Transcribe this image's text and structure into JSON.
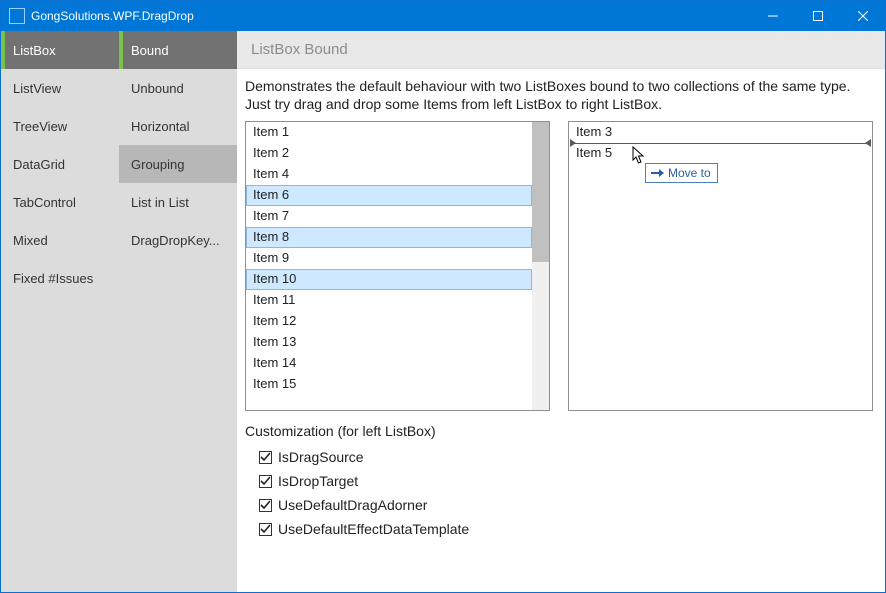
{
  "window": {
    "title": "GongSolutions.WPF.DragDrop"
  },
  "nav1": {
    "items": [
      {
        "label": "ListBox",
        "state": "active"
      },
      {
        "label": "ListView",
        "state": ""
      },
      {
        "label": "TreeView",
        "state": ""
      },
      {
        "label": "DataGrid",
        "state": ""
      },
      {
        "label": "TabControl",
        "state": ""
      },
      {
        "label": "Mixed",
        "state": ""
      },
      {
        "label": "Fixed #Issues",
        "state": ""
      }
    ]
  },
  "nav2": {
    "items": [
      {
        "label": "Bound",
        "state": "active"
      },
      {
        "label": "Unbound",
        "state": ""
      },
      {
        "label": "Horizontal",
        "state": ""
      },
      {
        "label": "Grouping",
        "state": "hover"
      },
      {
        "label": "List in List",
        "state": ""
      },
      {
        "label": "DragDropKey...",
        "state": ""
      }
    ]
  },
  "breadcrumb": "ListBox Bound",
  "description": "Demonstrates the default behaviour with two ListBoxes bound to two collections of the same type. Just try drag and drop some Items from left ListBox to right ListBox.",
  "leftList": [
    {
      "label": "Item 1",
      "selected": false
    },
    {
      "label": "Item 2",
      "selected": false
    },
    {
      "label": "Item 4",
      "selected": false
    },
    {
      "label": "Item 6",
      "selected": true
    },
    {
      "label": "Item 7",
      "selected": false
    },
    {
      "label": "Item 8",
      "selected": true
    },
    {
      "label": "Item 9",
      "selected": false
    },
    {
      "label": "Item 10",
      "selected": true
    },
    {
      "label": "Item 11",
      "selected": false
    },
    {
      "label": "Item 12",
      "selected": false
    },
    {
      "label": "Item 13",
      "selected": false
    },
    {
      "label": "Item 14",
      "selected": false
    },
    {
      "label": "Item 15",
      "selected": false
    }
  ],
  "rightList": [
    {
      "label": "Item 3"
    },
    {
      "label": "Item 5"
    }
  ],
  "adornerLabel": "Move to",
  "customization": {
    "caption": "Customization (for left ListBox)",
    "options": [
      {
        "label": "IsDragSource",
        "checked": true
      },
      {
        "label": "IsDropTarget",
        "checked": true
      },
      {
        "label": "UseDefaultDragAdorner",
        "checked": true
      },
      {
        "label": "UseDefaultEffectDataTemplate",
        "checked": true
      }
    ]
  }
}
